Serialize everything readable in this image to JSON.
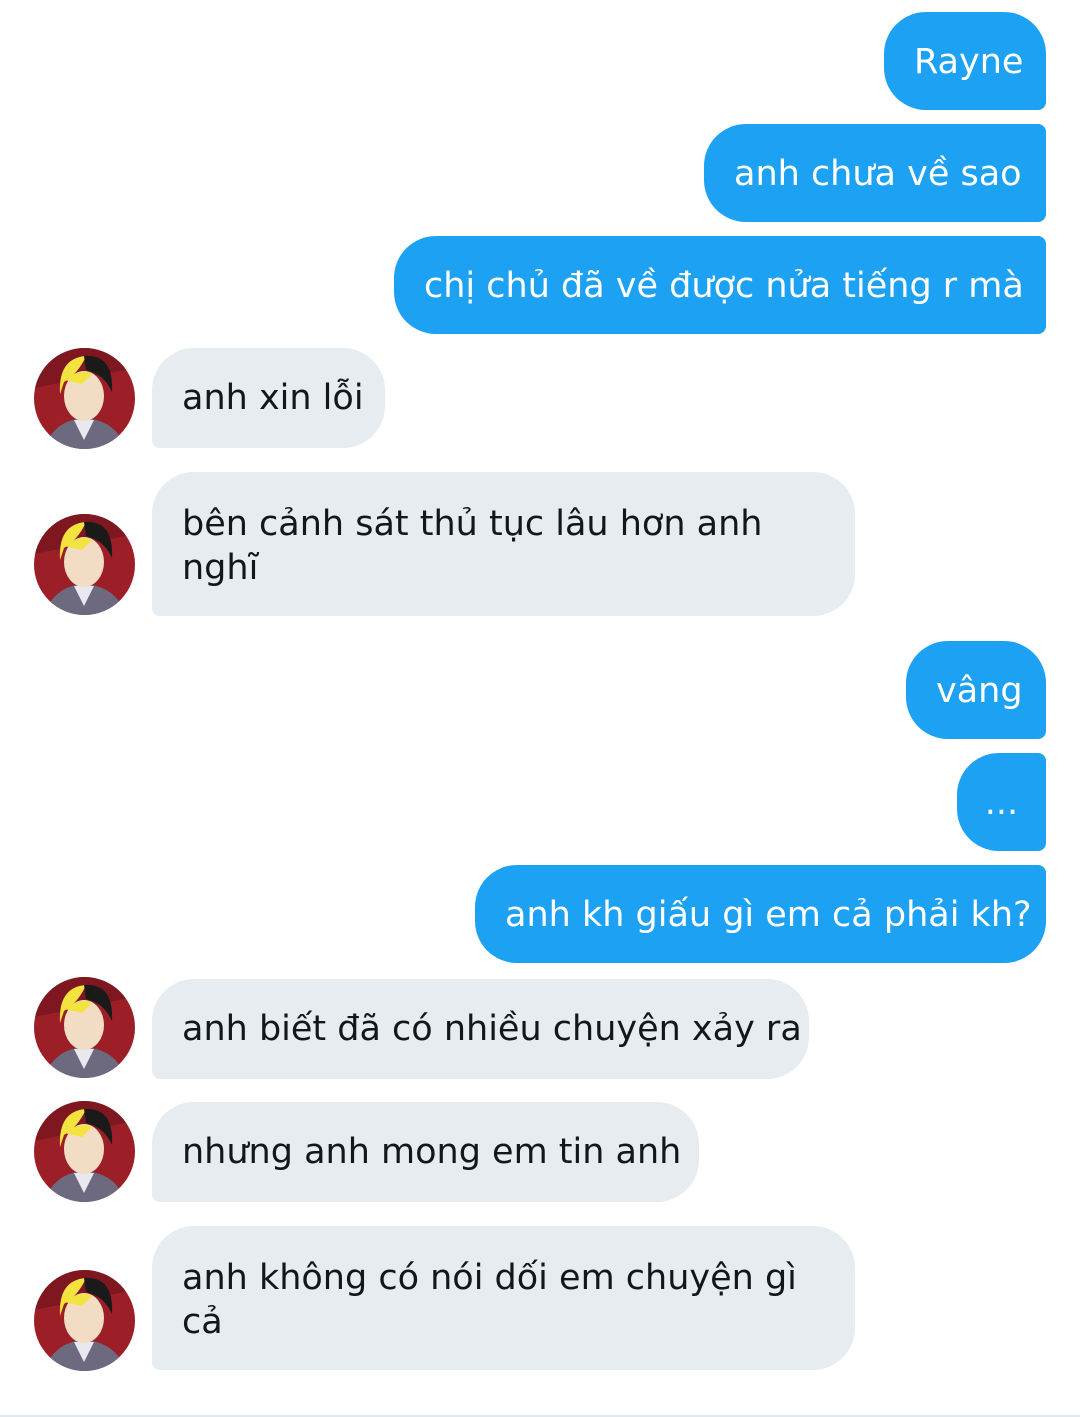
{
  "messages": [
    {
      "id": "m1",
      "direction": "outgoing",
      "text": "Rayne"
    },
    {
      "id": "m2",
      "direction": "outgoing",
      "text": "anh chưa về sao"
    },
    {
      "id": "m3",
      "direction": "outgoing",
      "text": "chị chủ đã về được nửa tiếng r mà"
    },
    {
      "id": "m4",
      "direction": "incoming",
      "text": "anh xin lỗi",
      "avatar": "contact-avatar"
    },
    {
      "id": "m5",
      "direction": "incoming",
      "text": "bên cảnh sát thủ tục lâu hơn anh nghĩ",
      "avatar": "contact-avatar"
    },
    {
      "id": "m6",
      "direction": "outgoing",
      "text": "vâng"
    },
    {
      "id": "m7",
      "direction": "outgoing",
      "text": "..."
    },
    {
      "id": "m8",
      "direction": "outgoing",
      "text": "anh kh giấu gì em cả phải kh?"
    },
    {
      "id": "m9",
      "direction": "incoming",
      "text": "anh biết đã có nhiều chuyện xảy ra",
      "avatar": "contact-avatar"
    },
    {
      "id": "m10",
      "direction": "incoming",
      "text": "nhưng anh mong em tin anh",
      "avatar": "contact-avatar"
    },
    {
      "id": "m11",
      "direction": "incoming",
      "text": "anh không có nói dối em chuyện gì cả",
      "avatar": "contact-avatar"
    }
  ],
  "colors": {
    "outgoing_bubble": "#1da1f2",
    "incoming_bubble": "#e6ecf0",
    "incoming_text": "#14171a",
    "outgoing_text": "#ffffff"
  }
}
